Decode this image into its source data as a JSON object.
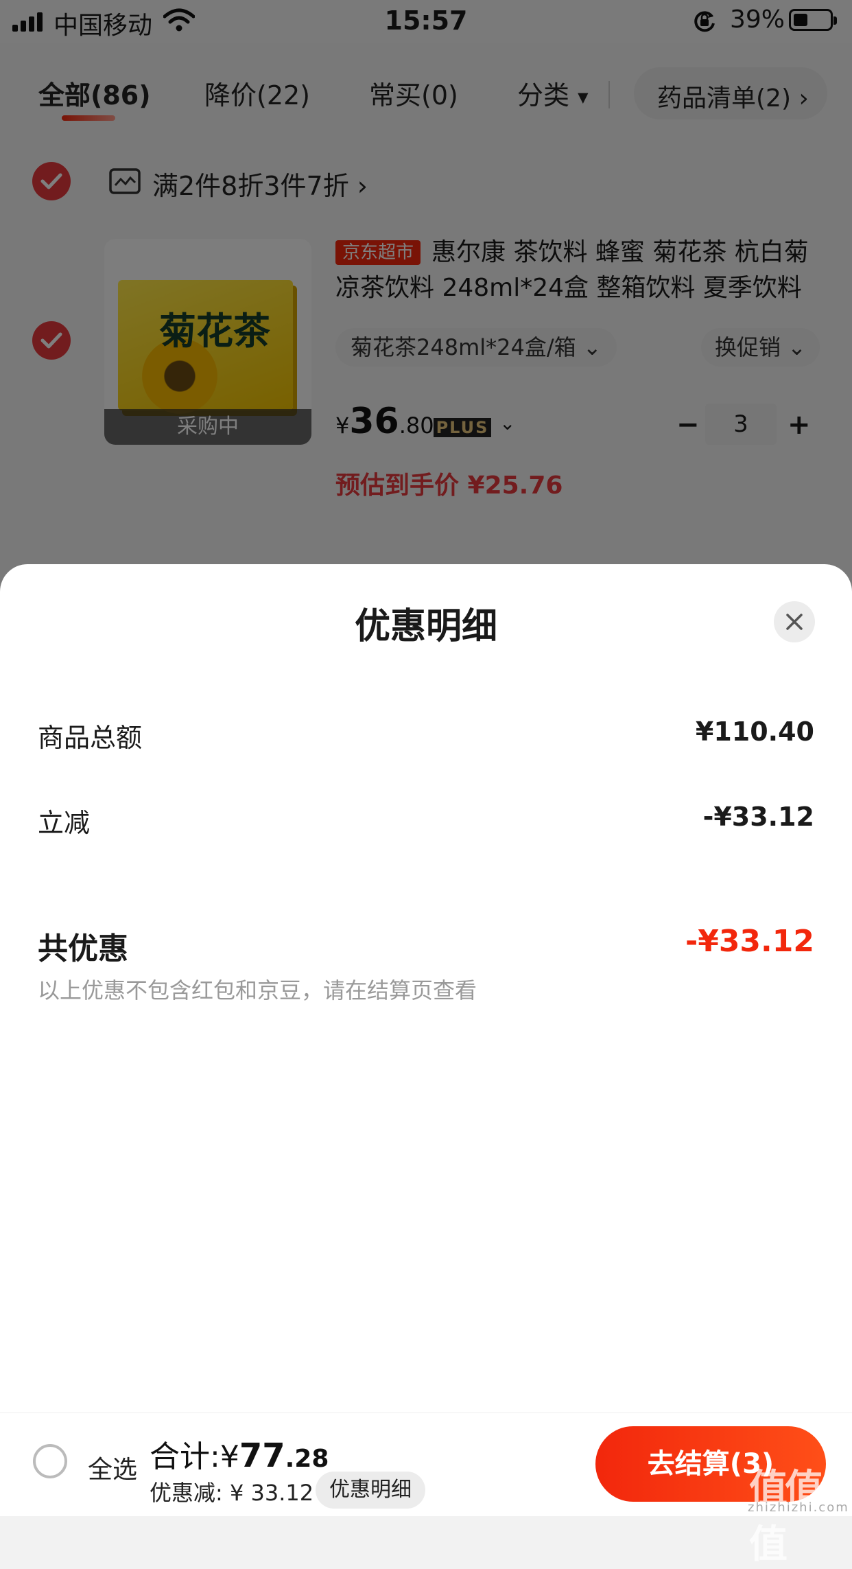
{
  "status_bar": {
    "carrier": "中国移动",
    "time": "15:57",
    "battery": "39%"
  },
  "tabs": [
    {
      "label": "全部(86)"
    },
    {
      "label": "降价(22)"
    },
    {
      "label": "常买(0)"
    },
    {
      "label": "分类"
    }
  ],
  "medicine_list": {
    "label": "药品清单(2) ›"
  },
  "promotion": {
    "text": "满2件8折3件7折 ›"
  },
  "product": {
    "image_status": "采购中",
    "image_text": "菊花茶",
    "tag": "京东超市",
    "title": "惠尔康 茶饮料 蜂蜜 菊花茶 杭白菊凉茶饮料 248ml*24盒 整箱饮料 夏季饮料",
    "spec": "菊花茶248ml*24盒/箱 ⌄",
    "promo_switch": "换促销 ⌄",
    "price_symbol": "¥",
    "price_int": "36",
    "price_dec": ".80",
    "plus_badge": "PLUS",
    "plus_chevron": "⌄",
    "quantity": "3",
    "minus": "−",
    "plus": "+",
    "estimate": "预估到手价 ¥25.76"
  },
  "sheet": {
    "title": "优惠明细",
    "rows": [
      {
        "label": "商品总额",
        "value": "¥110.40"
      },
      {
        "label": "立减",
        "value": "-¥33.12"
      }
    ],
    "total_label": "共优惠",
    "total_value": "-¥33.12",
    "note": "以上优惠不包含红包和京豆，请在结算页查看"
  },
  "bottom_bar": {
    "select_all": "全选",
    "sum_prefix": "合计:¥",
    "sum_int": "77",
    "sum_dec": ".28",
    "discount": "优惠减: ¥ 33.12",
    "detail_button": "优惠明细",
    "checkout": "去结算(3)"
  },
  "watermark": {
    "text": "值值值",
    "sub": "zhizhizhi.com"
  },
  "colors": {
    "accent": "#f2270c",
    "check_red": "#e4393c"
  }
}
